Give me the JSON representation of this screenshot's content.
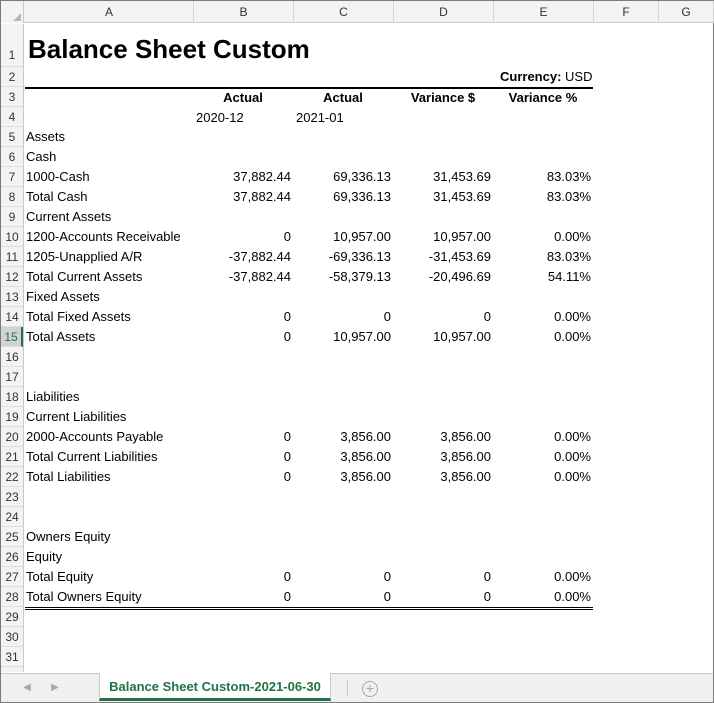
{
  "columns": [
    "A",
    "B",
    "C",
    "D",
    "E",
    "F",
    "G"
  ],
  "rows": [
    "1",
    "2",
    "3",
    "4",
    "5",
    "6",
    "7",
    "8",
    "9",
    "10",
    "11",
    "12",
    "13",
    "14",
    "15",
    "16",
    "17",
    "18",
    "19",
    "20",
    "21",
    "22",
    "23",
    "24",
    "25",
    "26",
    "27",
    "28",
    "29",
    "30",
    "31"
  ],
  "selected_row": "15",
  "sheet": {
    "title": "Balance Sheet Custom",
    "currency_label": "Currency:",
    "currency_value": "USD",
    "headers": {
      "actual_1": "Actual",
      "actual_2": "Actual",
      "variance_dollar": "Variance $",
      "variance_pct": "Variance %",
      "period_1": "2020-12",
      "period_2": "2021-01"
    },
    "lines": [
      {
        "row": 5,
        "label": "Assets",
        "b": "",
        "c": "",
        "d": "",
        "e": ""
      },
      {
        "row": 6,
        "label": "Cash",
        "b": "",
        "c": "",
        "d": "",
        "e": ""
      },
      {
        "row": 7,
        "label": "1000-Cash",
        "b": "37,882.44",
        "c": "69,336.13",
        "d": "31,453.69",
        "e": "83.03%"
      },
      {
        "row": 8,
        "label": "Total Cash",
        "b": "37,882.44",
        "c": "69,336.13",
        "d": "31,453.69",
        "e": "83.03%"
      },
      {
        "row": 9,
        "label": "Current Assets",
        "b": "",
        "c": "",
        "d": "",
        "e": ""
      },
      {
        "row": 10,
        "label": "1200-Accounts Receivable",
        "b": "0",
        "c": "10,957.00",
        "d": "10,957.00",
        "e": "0.00%"
      },
      {
        "row": 11,
        "label": "1205-Unapplied A/R",
        "b": "-37,882.44",
        "c": "-69,336.13",
        "d": "-31,453.69",
        "e": "83.03%"
      },
      {
        "row": 12,
        "label": "Total Current Assets",
        "b": "-37,882.44",
        "c": "-58,379.13",
        "d": "-20,496.69",
        "e": "54.11%"
      },
      {
        "row": 13,
        "label": "Fixed Assets",
        "b": "",
        "c": "",
        "d": "",
        "e": ""
      },
      {
        "row": 14,
        "label": "Total Fixed Assets",
        "b": "0",
        "c": "0",
        "d": "0",
        "e": "0.00%"
      },
      {
        "row": 15,
        "label": "Total Assets",
        "b": "0",
        "c": "10,957.00",
        "d": "10,957.00",
        "e": "0.00%"
      },
      {
        "row": 18,
        "label": "Liabilities",
        "b": "",
        "c": "",
        "d": "",
        "e": ""
      },
      {
        "row": 19,
        "label": "Current Liabilities",
        "b": "",
        "c": "",
        "d": "",
        "e": ""
      },
      {
        "row": 20,
        "label": "2000-Accounts Payable",
        "b": "0",
        "c": "3,856.00",
        "d": "3,856.00",
        "e": "0.00%"
      },
      {
        "row": 21,
        "label": "Total Current Liabilities",
        "b": "0",
        "c": "3,856.00",
        "d": "3,856.00",
        "e": "0.00%"
      },
      {
        "row": 22,
        "label": "Total Liabilities",
        "b": "0",
        "c": "3,856.00",
        "d": "3,856.00",
        "e": "0.00%"
      },
      {
        "row": 25,
        "label": "Owners Equity",
        "b": "",
        "c": "",
        "d": "",
        "e": ""
      },
      {
        "row": 26,
        "label": "Equity",
        "b": "",
        "c": "",
        "d": "",
        "e": ""
      },
      {
        "row": 27,
        "label": "Total Equity",
        "b": "0",
        "c": "0",
        "d": "0",
        "e": "0.00%"
      },
      {
        "row": 28,
        "label": "Total Owners Equity",
        "b": "0",
        "c": "0",
        "d": "0",
        "e": "0.00%"
      }
    ]
  },
  "tabs": {
    "active_sheet": "Balance Sheet Custom-2021-06-30",
    "prev_icon": "chevron-left-icon",
    "next_icon": "chevron-right-icon",
    "add_icon": "plus-circle-icon",
    "prev_glyph": "◀",
    "next_glyph": "▶",
    "add_glyph": "+"
  },
  "colors": {
    "accent": "#217346",
    "header_bg": "#f3f3f3"
  }
}
